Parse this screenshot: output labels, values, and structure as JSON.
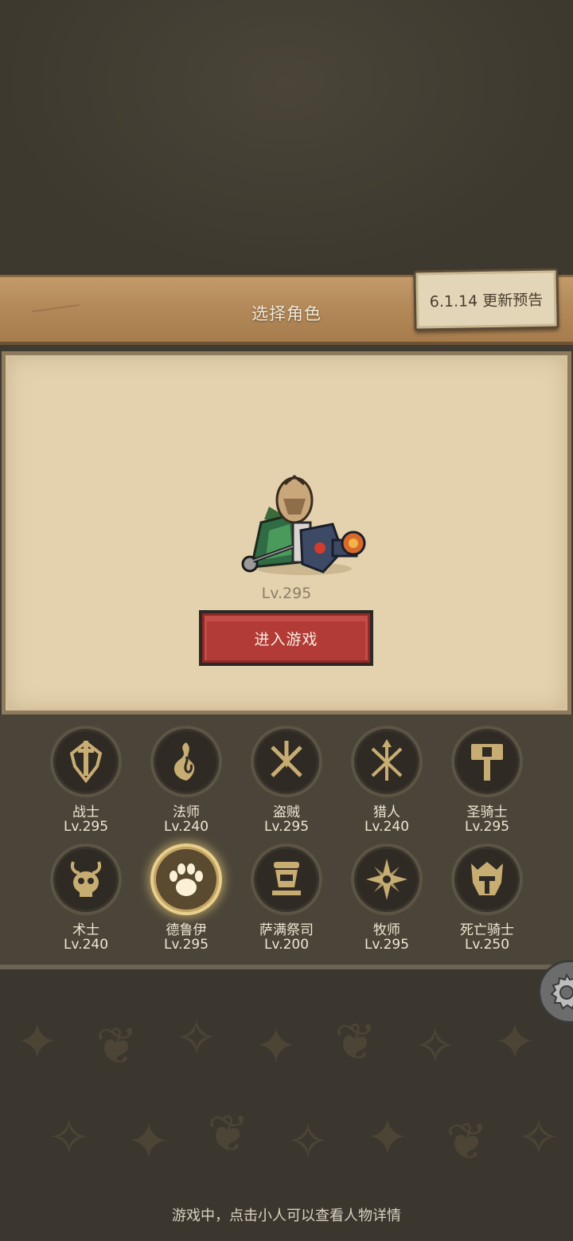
{
  "header": {
    "title": "选择角色",
    "update_notice": "6.1.14 更新预告"
  },
  "selected_character": {
    "level": "Lv.295",
    "enter_button": "进入游戏"
  },
  "classes": [
    {
      "name": "战士",
      "level": "Lv.295",
      "icon": "sword-shield-icon"
    },
    {
      "name": "法师",
      "level": "Lv.240",
      "icon": "flame-icon"
    },
    {
      "name": "盗贼",
      "level": "Lv.295",
      "icon": "crossed-daggers-icon"
    },
    {
      "name": "猎人",
      "level": "Lv.240",
      "icon": "crossed-arrows-icon"
    },
    {
      "name": "圣骑士",
      "level": "Lv.295",
      "icon": "hammer-icon"
    },
    {
      "name": "术士",
      "level": "Lv.240",
      "icon": "skull-icon"
    },
    {
      "name": "德鲁伊",
      "level": "Lv.295",
      "icon": "paw-icon",
      "selected": true
    },
    {
      "name": "萨满祭司",
      "level": "Lv.200",
      "icon": "totem-icon"
    },
    {
      "name": "牧师",
      "level": "Lv.295",
      "icon": "star-icon"
    },
    {
      "name": "死亡骑士",
      "level": "Lv.250",
      "icon": "helmet-icon"
    }
  ],
  "footer": {
    "hint": "游戏中，点击小人可以查看人物详情"
  },
  "colors": {
    "background": "#3f3b32",
    "banner": "#b58b5b",
    "panel": "#e4d2ae",
    "enter_button": "#b23b36",
    "icon_gold": "#c8ad72",
    "selected_glow": "#e8cf8c"
  }
}
